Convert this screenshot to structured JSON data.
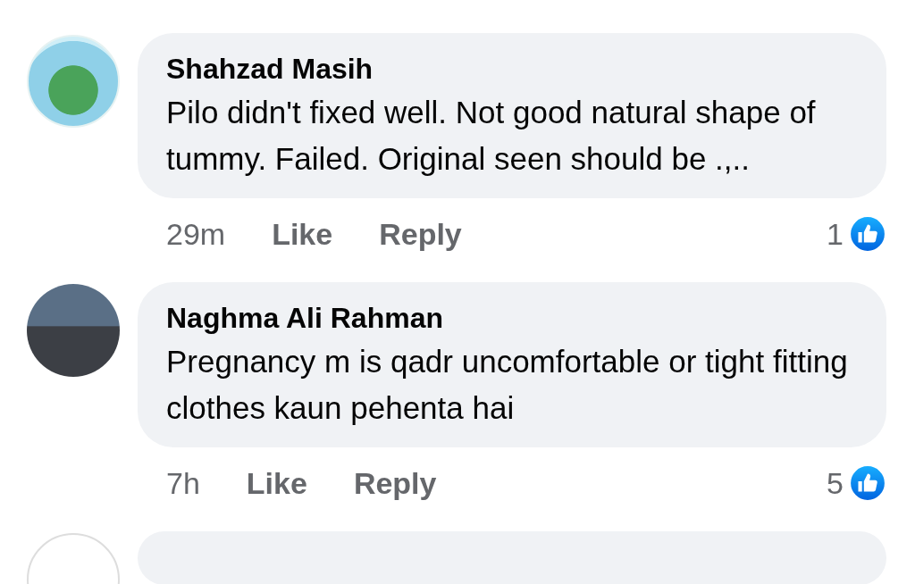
{
  "comments": [
    {
      "author": "Shahzad Masih",
      "text": "Pilo didn't fixed well. Not good natural shape of tummy. Failed. Original seen should be .,..",
      "time": "29m",
      "like": "Like",
      "reply": "Reply",
      "reactions": "1"
    },
    {
      "author": "Naghma Ali Rahman",
      "text": "Pregnancy m is qadr uncomfortable or tight fitting clothes kaun pehenta hai",
      "time": "7h",
      "like": "Like",
      "reply": "Reply",
      "reactions": "5"
    }
  ]
}
